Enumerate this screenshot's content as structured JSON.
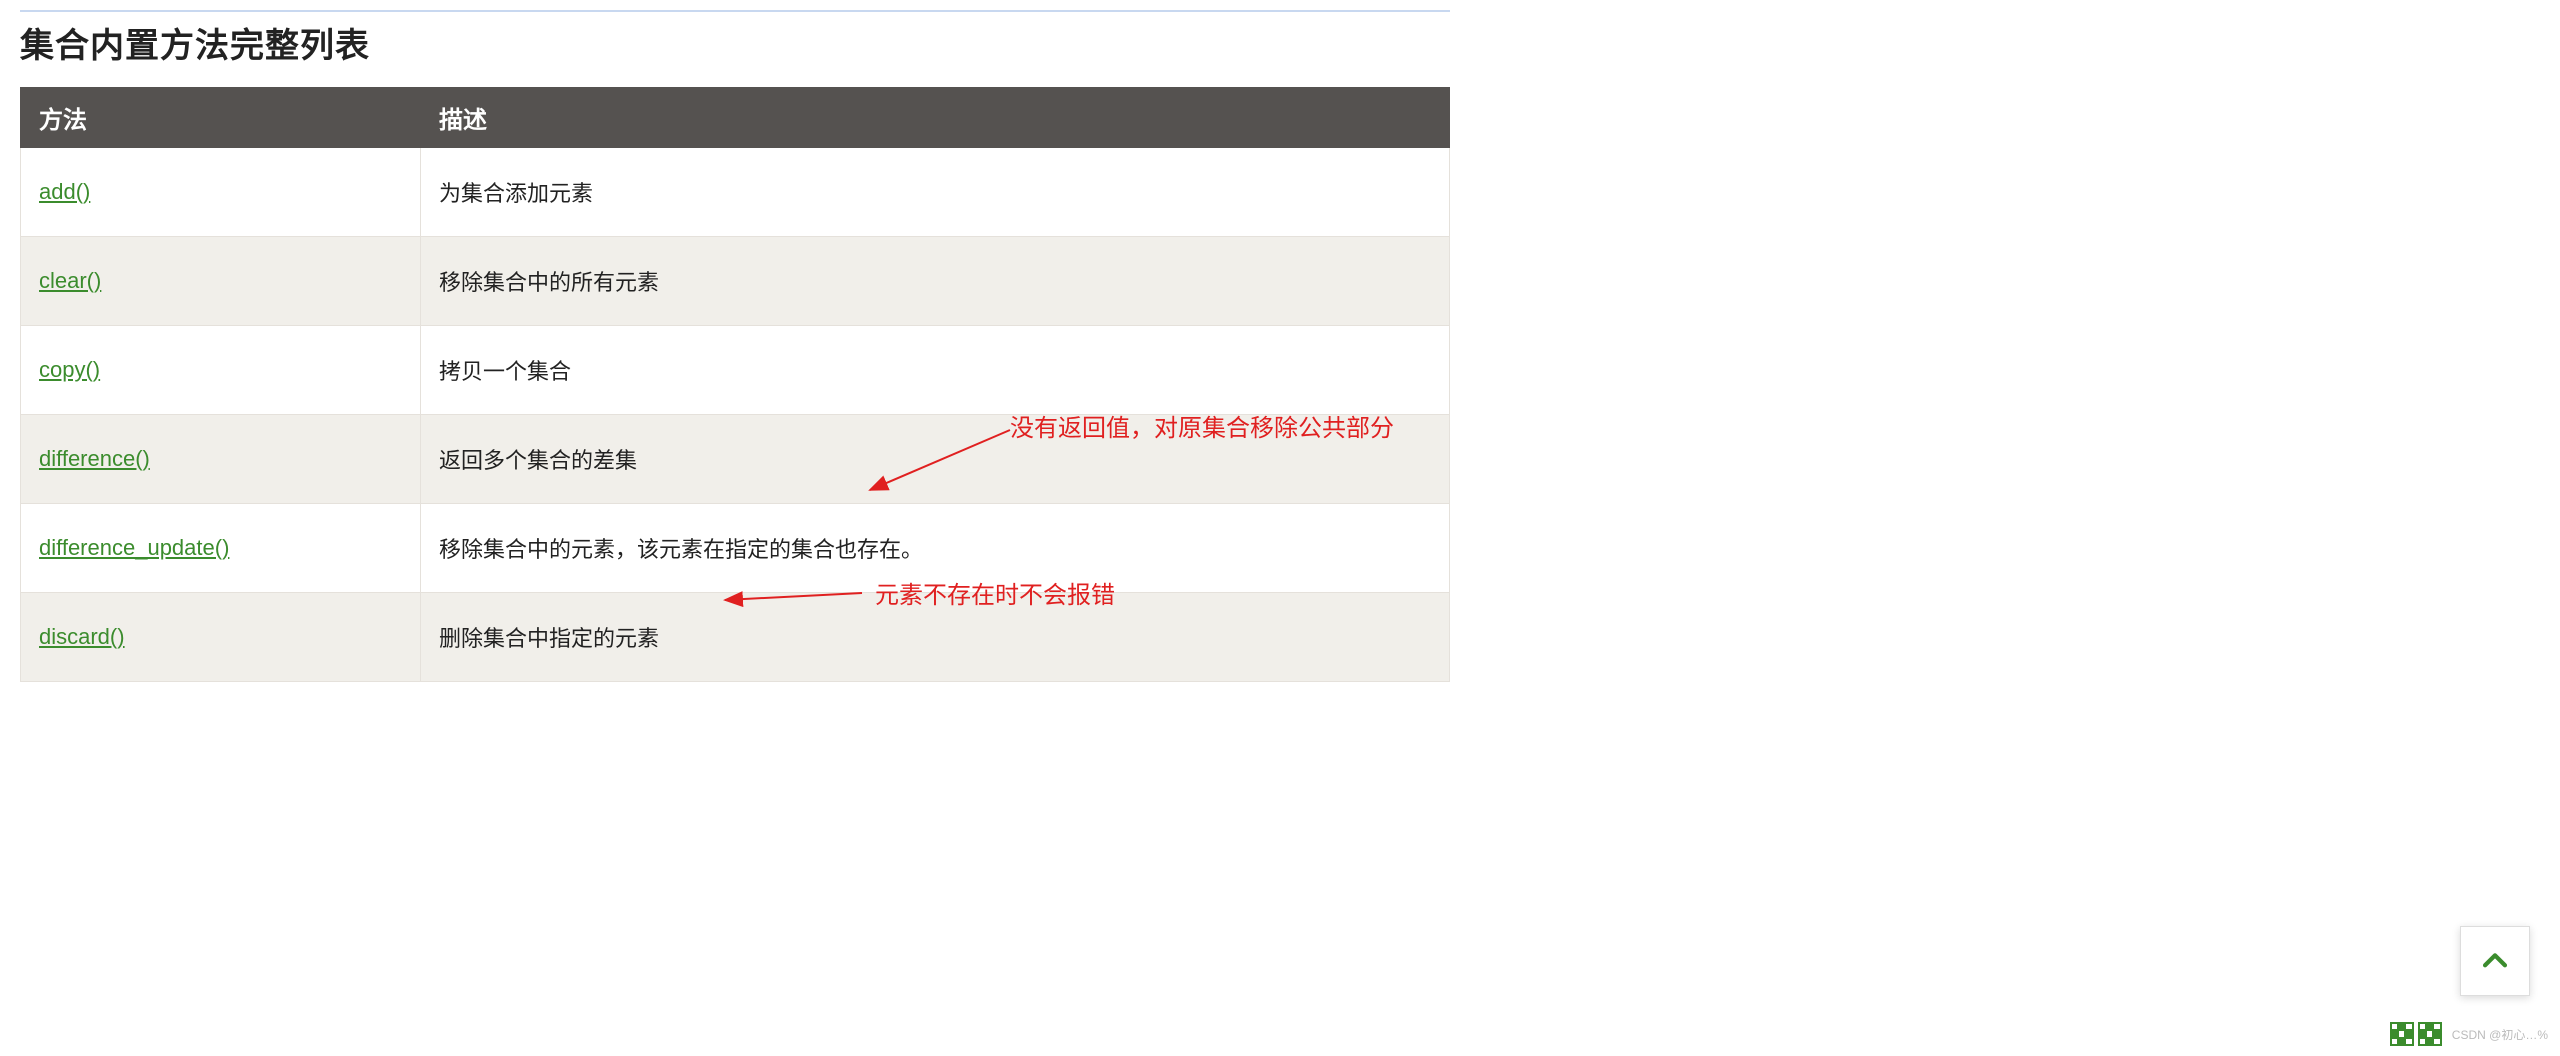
{
  "title": "集合内置方法完整列表",
  "headers": {
    "method": "方法",
    "desc": "描述"
  },
  "rows": [
    {
      "method": "add()",
      "desc": "为集合添加元素"
    },
    {
      "method": "clear()",
      "desc": "移除集合中的所有元素"
    },
    {
      "method": "copy()",
      "desc": "拷贝一个集合"
    },
    {
      "method": "difference()",
      "desc": "返回多个集合的差集"
    },
    {
      "method": "difference_update()",
      "desc": "移除集合中的元素，该元素在指定的集合也存在。"
    },
    {
      "method": "discard()",
      "desc": "删除集合中指定的元素"
    }
  ],
  "annotations": {
    "note1": "没有返回值，对原集合移除公共部分",
    "note2": "元素不存在时不会报错"
  },
  "watermark": "CSDN @初心…%"
}
